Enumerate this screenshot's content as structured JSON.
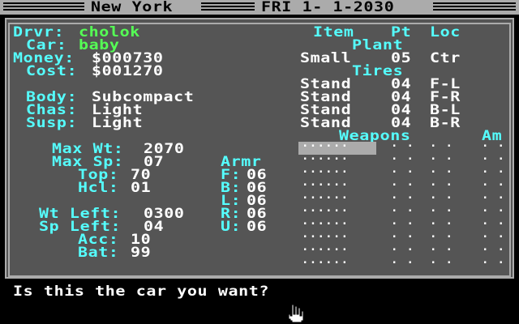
{
  "title": {
    "city": "New York",
    "date": "FRI 1- 1-2030"
  },
  "driver": {
    "label": "Drvr:",
    "value": "cholok"
  },
  "car": {
    "label": "Car:",
    "value": "baby"
  },
  "money": {
    "label": "Money:",
    "value": "$000730"
  },
  "cost": {
    "label": "Cost:",
    "value": "$001270"
  },
  "body": {
    "label": "Body:",
    "value": "Subcompact"
  },
  "chassis": {
    "label": "Chas:",
    "value": "Light"
  },
  "suspension": {
    "label": "Susp:",
    "value": "Light"
  },
  "max_wt": {
    "label": "Max Wt:",
    "value": "2070"
  },
  "max_sp": {
    "label": "Max Sp:",
    "value": "07"
  },
  "top": {
    "label": "Top:",
    "value": "70"
  },
  "hcl": {
    "label": "Hcl:",
    "value": "01"
  },
  "wt_left": {
    "label": "Wt Left:",
    "value": "0300"
  },
  "sp_left": {
    "label": "Sp Left:",
    "value": "04"
  },
  "acc": {
    "label": "Acc:",
    "value": "10"
  },
  "bat": {
    "label": "Bat:",
    "value": "99"
  },
  "armor": {
    "heading": "Armr",
    "rows": [
      {
        "label": "F:",
        "value": "06"
      },
      {
        "label": "B:",
        "value": "06"
      },
      {
        "label": "L:",
        "value": "06"
      },
      {
        "label": "R:",
        "value": "06"
      },
      {
        "label": "U:",
        "value": "06"
      }
    ]
  },
  "table_header": {
    "item": "Item",
    "pt": "Pt",
    "loc": "Loc"
  },
  "plant": {
    "heading": "Plant",
    "item": "Small",
    "pt": "05",
    "loc": "Ctr"
  },
  "tires": {
    "heading": "Tires",
    "rows": [
      {
        "item": "Stand",
        "pt": "04",
        "loc": "F-L"
      },
      {
        "item": "Stand",
        "pt": "04",
        "loc": "F-R"
      },
      {
        "item": "Stand",
        "pt": "04",
        "loc": "B-L"
      },
      {
        "item": "Stand",
        "pt": "04",
        "loc": "B-R"
      }
    ]
  },
  "weapons": {
    "heading": "Weapons",
    "am_heading": "Am",
    "slot_count": 10
  },
  "message": "Is this the car you want?",
  "colors": {
    "cyan": "#55ffff",
    "green": "#55ff55",
    "white": "#ffffff",
    "panel": "#555555",
    "border": "#ababab"
  }
}
